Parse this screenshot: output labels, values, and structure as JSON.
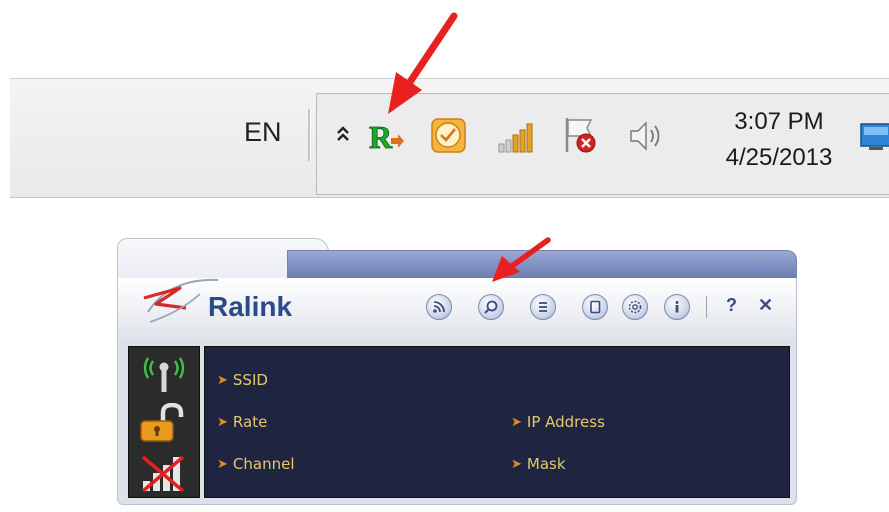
{
  "taskbar": {
    "language": "EN",
    "clock_time": "3:07 PM",
    "clock_date": "4/25/2013",
    "tray_icons": [
      "show-hidden-icons-chevron",
      "ralink-utility-icon",
      "clock-app-icon",
      "wireless-signal-icon",
      "action-center-flag-icon",
      "speaker-icon",
      "show-desktop-icon"
    ]
  },
  "window": {
    "brand": "Ralink",
    "toolbar": {
      "buttons": [
        "rss-icon",
        "search-icon",
        "list-icon",
        "page-icon",
        "gear-icon",
        "info-icon"
      ],
      "help_label": "?",
      "close_label": "✕"
    },
    "fields": {
      "ssid_label": "SSID",
      "rate_label": "Rate",
      "channel_label": "Channel",
      "ip_label": "IP Address",
      "mask_label": "Mask"
    },
    "status_icons": [
      "antenna-icon",
      "unlocked-padlock-icon",
      "no-signal-icon"
    ]
  },
  "colors": {
    "panel_bg": "#1f2540",
    "field_text": "#e4c96a",
    "bullet": "#e68a1f",
    "annotation_arrow": "#e82020",
    "brand": "#2c4a8a"
  }
}
